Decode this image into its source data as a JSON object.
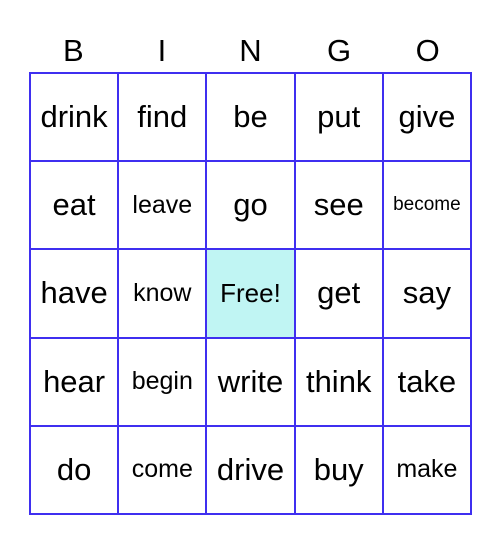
{
  "header": [
    "B",
    "I",
    "N",
    "G",
    "O"
  ],
  "colors": {
    "grid_line": "#3f2ff0",
    "free_bg": "#c0f5f3"
  },
  "cells": [
    [
      "drink",
      "find",
      "be",
      "put",
      "give"
    ],
    [
      "eat",
      "leave",
      "go",
      "see",
      "become"
    ],
    [
      "have",
      "know",
      "Free!",
      "get",
      "say"
    ],
    [
      "hear",
      "begin",
      "write",
      "think",
      "take"
    ],
    [
      "do",
      "come",
      "drive",
      "buy",
      "make"
    ]
  ]
}
